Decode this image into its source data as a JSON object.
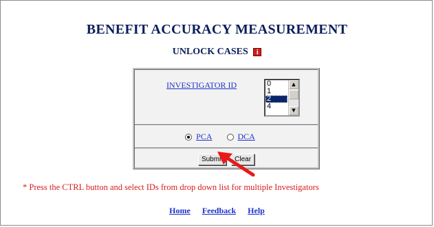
{
  "header": {
    "title": "BENEFIT ACCURACY MEASUREMENT",
    "subtitle": "UNLOCK CASES",
    "info_icon": "i"
  },
  "form": {
    "investigator_label": "INVESTIGATOR ID",
    "investigator_options": [
      "0",
      "1",
      "2",
      "4"
    ],
    "selected_option": "2",
    "radio_options": [
      {
        "label": "PCA",
        "checked": true
      },
      {
        "label": "DCA",
        "checked": false
      }
    ],
    "submit_label": "Submit",
    "clear_label": "Clear"
  },
  "note": "* Press the CTRL button and select IDs from drop down list for multiple Investigators",
  "footer": {
    "links": [
      "Home",
      "Feedback",
      "Help"
    ]
  },
  "annotation": {
    "arrow_color": "#e81a1a"
  }
}
